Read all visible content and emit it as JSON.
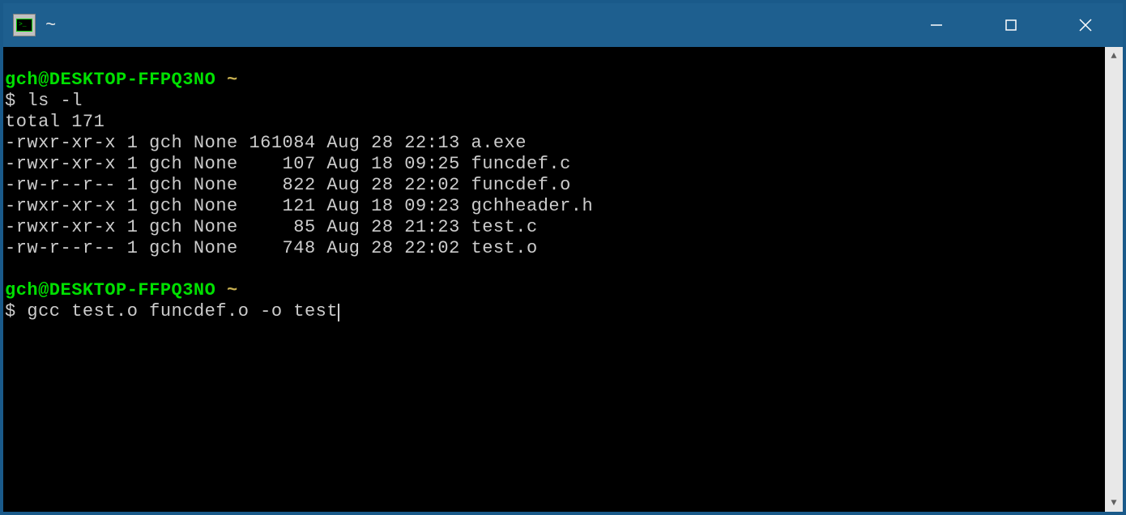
{
  "titlebar": {
    "title": "~"
  },
  "colors": {
    "titlebar_bg": "#1e5f8f",
    "terminal_bg": "#000000",
    "terminal_fg": "#cccccc",
    "prompt_user": "#00e000",
    "prompt_path": "#c8b050"
  },
  "session": {
    "blocks": [
      {
        "prompt_user_host": "gch@DESKTOP-FFPQ3NO",
        "prompt_path": "~",
        "prompt_symbol": "$",
        "command": "ls -l",
        "output_lines": [
          "total 171",
          "-rwxr-xr-x 1 gch None 161084 Aug 28 22:13 a.exe",
          "-rwxr-xr-x 1 gch None    107 Aug 18 09:25 funcdef.c",
          "-rw-r--r-- 1 gch None    822 Aug 28 22:02 funcdef.o",
          "-rwxr-xr-x 1 gch None    121 Aug 18 09:23 gchheader.h",
          "-rwxr-xr-x 1 gch None     85 Aug 28 21:23 test.c",
          "-rw-r--r-- 1 gch None    748 Aug 28 22:02 test.o"
        ]
      },
      {
        "prompt_user_host": "gch@DESKTOP-FFPQ3NO",
        "prompt_path": "~",
        "prompt_symbol": "$",
        "command": "gcc test.o funcdef.o -o test",
        "is_current": true
      }
    ]
  }
}
